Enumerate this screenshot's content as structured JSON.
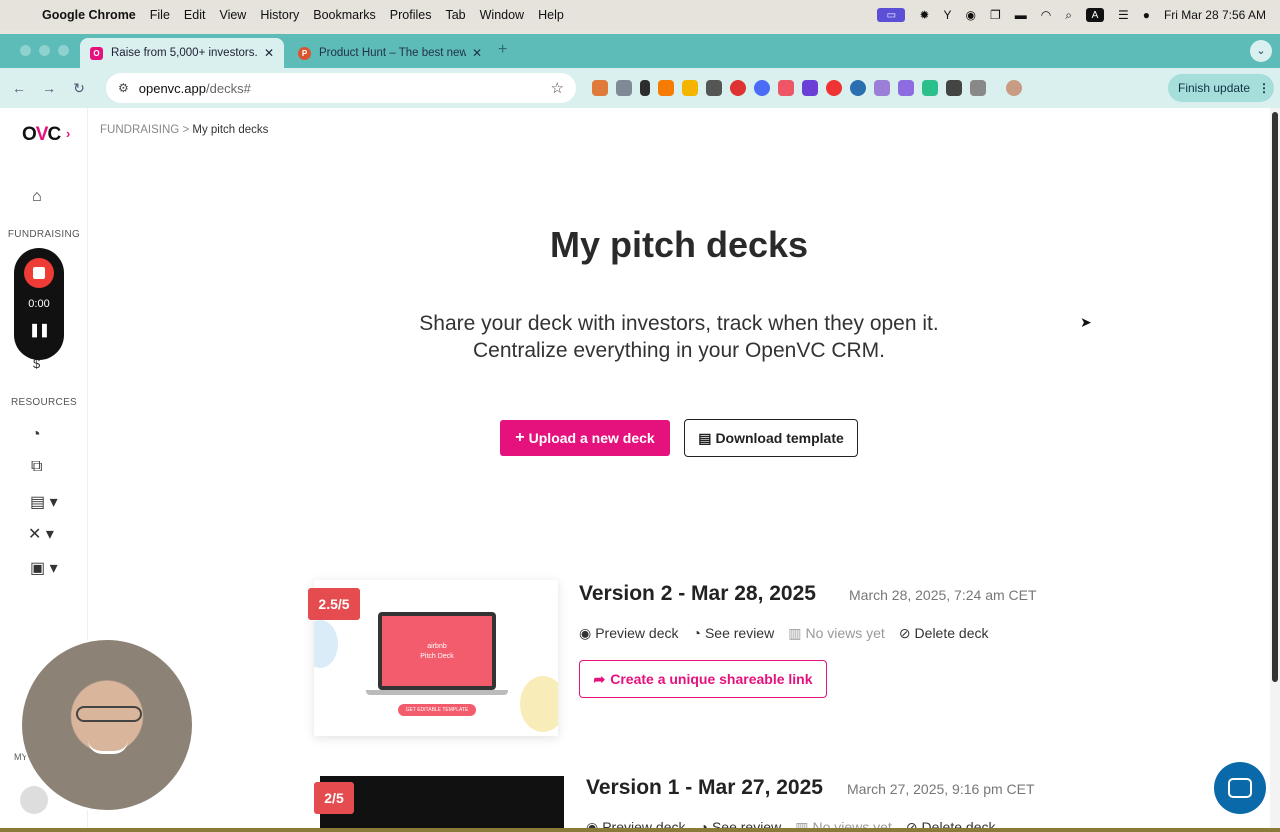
{
  "menubar": {
    "app": "Google Chrome",
    "items": [
      "File",
      "Edit",
      "View",
      "History",
      "Bookmarks",
      "Profiles",
      "Tab",
      "Window",
      "Help"
    ],
    "clock": "Fri Mar 28  7:56 AM"
  },
  "tabs": [
    {
      "title": "Raise from 5,000+ investors.",
      "favicon_color": "#e5127d",
      "active": true
    },
    {
      "title": "Product Hunt – The best new",
      "favicon_color": "#da552f",
      "active": false
    }
  ],
  "toolbar": {
    "url_domain": "openvc.app",
    "url_path": "/decks#",
    "finish_update": "Finish update"
  },
  "sidebar": {
    "logo_prefix": "O",
    "logo_v": "V",
    "logo_suffix": "C",
    "section_fundraising": "FUNDRAISING",
    "section_resources": "RESOURCES",
    "section_my": "MY",
    "recorder_time": "0:00"
  },
  "breadcrumb": {
    "parent": "FUNDRAISING",
    "separator": ">",
    "current": "My pitch decks"
  },
  "main": {
    "title": "My pitch decks",
    "subtitle_line1": "Share your deck with investors, track when they open it.",
    "subtitle_line2": "Centralize everything in your OpenVC CRM.",
    "upload_label": "Upload a new deck",
    "template_label": "Download template"
  },
  "decks": [
    {
      "badge": "2.5/5",
      "title": "Version 2 - Mar 28, 2025",
      "date": "March 28, 2025, 7:24 am CET",
      "preview": "Preview deck",
      "review": "See review",
      "views": "No views yet",
      "delete": "Delete deck",
      "share_label": "Create a unique shareable link",
      "thumb_brand": "airbnb",
      "thumb_title": "Pitch Deck",
      "thumb_button": "GET EDITABLE TEMPLATE"
    },
    {
      "badge": "2/5",
      "title": "Version 1 - Mar 27, 2025",
      "date": "March 27, 2025, 9:16 pm CET",
      "preview": "Preview deck",
      "review": "See review",
      "views": "No views yet",
      "delete": "Delete deck"
    }
  ],
  "colors": {
    "brand": "#e5127d",
    "badge": "#e44c4f",
    "chrome_tab": "#5dbcb8"
  }
}
